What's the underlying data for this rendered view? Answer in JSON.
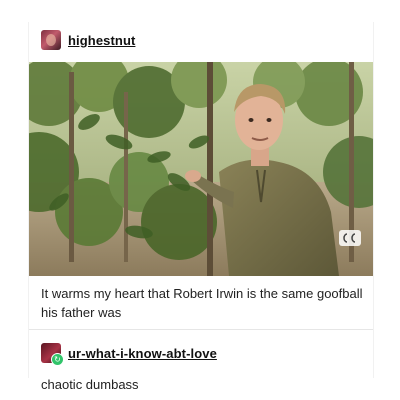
{
  "post": {
    "author": "highestnut",
    "caption": "It warms my heart that Robert Irwin is the same goofball his father was"
  },
  "reblog": {
    "author": "ur-what-i-know-abt-love",
    "text": "chaotic dumbass"
  },
  "icons": {
    "author_avatar": "avatar-image",
    "reblog_avatar": "avatar-image",
    "reblog_badge": "reblog-icon",
    "video_caption": "closed-caption-icon"
  },
  "colors": {
    "background": "#ffffff",
    "text": "#111111",
    "reblog_badge": "#31c46a",
    "divider": "#e6e6e6"
  }
}
